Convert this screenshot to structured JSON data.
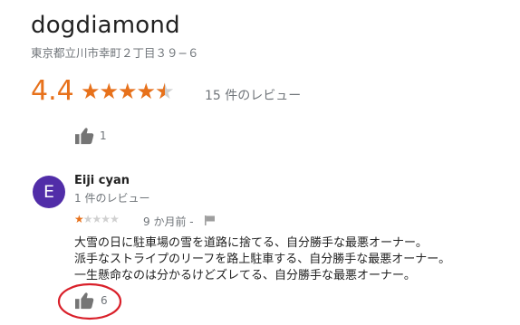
{
  "place": {
    "name": "dogdiamond",
    "address": "東京都立川市幸町２丁目３９−６",
    "rating": "4.4",
    "stars_value": 4.4,
    "stars_max": 5,
    "review_count_text": "15 件のレビュー"
  },
  "top_like": {
    "icon": "thumbs-up-icon",
    "count": "1"
  },
  "review": {
    "avatar_letter": "E",
    "avatar_color": "#512da8",
    "reviewer_name": "Eiji cyan",
    "reviewer_reviews": "1 件のレビュー",
    "stars_value": 1,
    "stars_max": 5,
    "time": "9 か月前 -",
    "flag_icon": "flag-icon",
    "text": {
      "line1": "大雪の日に駐車場の雪を道路に捨てる、自分勝手な最悪オーナー。",
      "line2": "派手なストライプのリーフを路上駐車する、自分勝手な最悪オーナー。",
      "line3": "一生懸命なのは分かるけどズレてる、自分勝手な最悪オーナー。"
    },
    "like": {
      "icon": "thumbs-up-icon",
      "count": "6"
    }
  },
  "colors": {
    "rating_orange": "#e7711b",
    "star_empty": "#d0d0d0",
    "secondary_text": "#70757a",
    "annotation_red": "#d9202a"
  }
}
